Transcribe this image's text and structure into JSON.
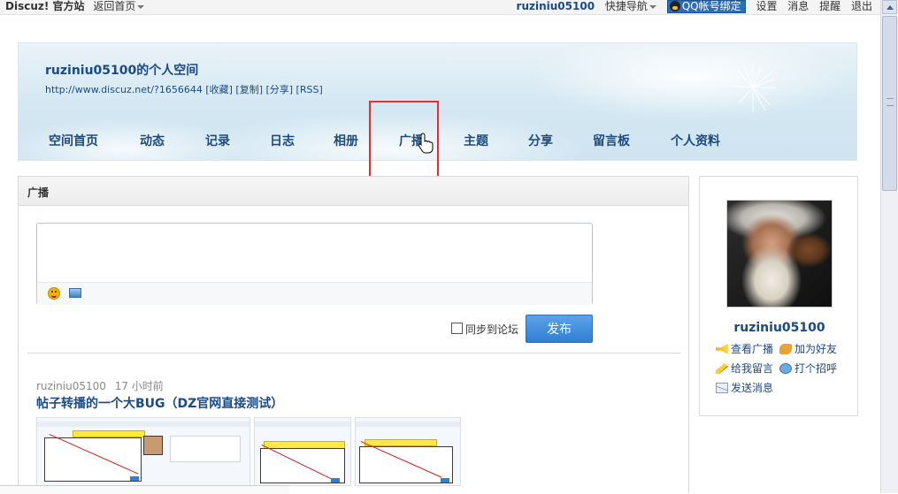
{
  "topbar": {
    "site": "Discuz! 官方站",
    "back": "返回首页",
    "username": "ruziniu05100",
    "quick_nav": "快捷导航",
    "qq_bind": "QQ帐号绑定",
    "settings": "设置",
    "messages": "消息",
    "reminders": "提醒",
    "logout": "退出"
  },
  "banner": {
    "space_title": "ruziniu05100的个人空间",
    "space_url": "http://www.discuz.net/?1656644 [收藏] [复制] [分享] [RSS]",
    "nav": [
      "空间首页",
      "动态",
      "记录",
      "日志",
      "相册",
      "广播",
      "主题",
      "分享",
      "留言板",
      "个人资料"
    ]
  },
  "main": {
    "section_title": "广播",
    "composer_value": "",
    "sync_label": "同步到论坛",
    "publish_label": "发布",
    "post": {
      "author": "ruziniu05100",
      "time": "17 小时前",
      "title": "帖子转播的一个大BUG（DZ官网直接测试）"
    }
  },
  "profile": {
    "username": "ruziniu05100",
    "actions": [
      "查看广播",
      "加为好友",
      "给我留言",
      "打个招呼",
      "发送消息"
    ]
  },
  "colors": {
    "link_blue": "#1a4a8a",
    "highlight_red": "#e23030",
    "publish_blue": "#2f7fd2"
  }
}
